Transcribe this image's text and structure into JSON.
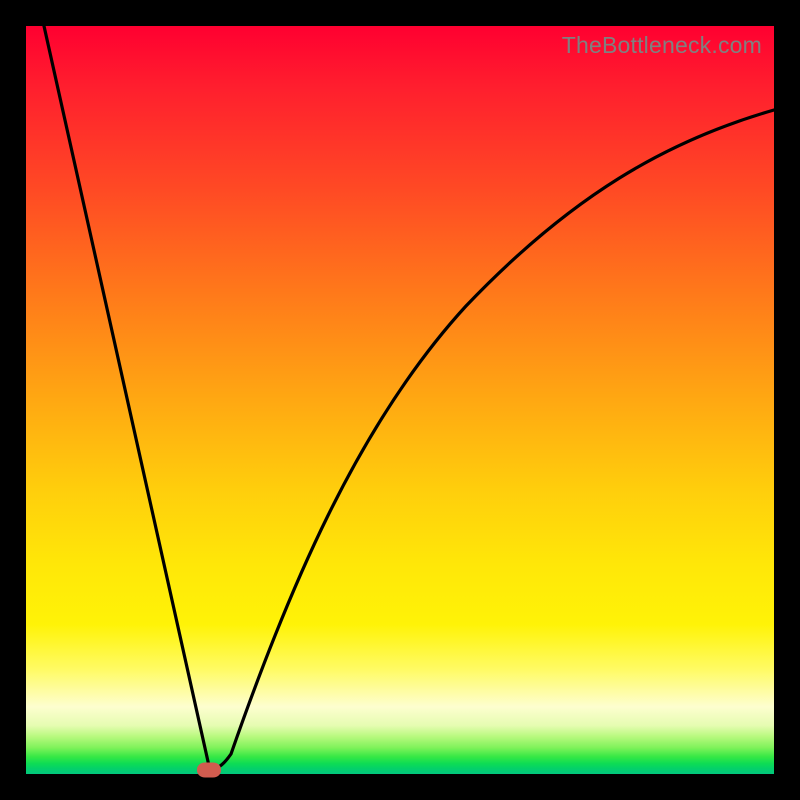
{
  "watermark": "TheBottleneck.com",
  "colors": {
    "frame": "#000000",
    "gradient_top": "#ff0030",
    "gradient_mid": "#ffe708",
    "gradient_bottom": "#02c77e",
    "curve": "#000000",
    "marker": "#d15c4f"
  },
  "chart_data": {
    "type": "line",
    "title": "",
    "xlabel": "",
    "ylabel": "",
    "xlim": [
      0,
      100
    ],
    "ylim": [
      0,
      100
    ],
    "grid": false,
    "annotations": [
      "TheBottleneck.com"
    ],
    "series": [
      {
        "name": "curve",
        "x": [
          0,
          5,
          10,
          15,
          20,
          24,
          25,
          26,
          30,
          35,
          40,
          45,
          50,
          55,
          60,
          65,
          70,
          75,
          80,
          85,
          90,
          95,
          100
        ],
        "y": [
          100,
          80,
          60,
          40,
          20,
          2,
          0,
          1,
          10,
          25,
          38,
          49,
          58,
          66,
          72,
          77,
          81,
          84,
          86.5,
          88.5,
          90,
          91,
          92
        ]
      }
    ],
    "marker": {
      "x": 24.5,
      "y": 0.5
    }
  }
}
